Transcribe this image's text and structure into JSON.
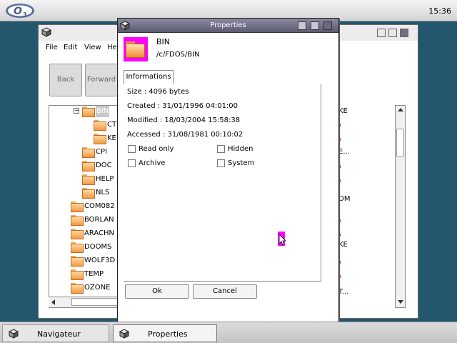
{
  "clock": "15:36",
  "navigator": {
    "menu": [
      "File",
      "Edit",
      "View",
      "He"
    ],
    "buttons": {
      "back": "Back",
      "forward": "Forward"
    },
    "tree": [
      {
        "label": "BIN",
        "indent": 2
      },
      {
        "label": "CT",
        "indent": 3
      },
      {
        "label": "KE",
        "indent": 3
      },
      {
        "label": "CPI",
        "indent": 1
      },
      {
        "label": "DOC",
        "indent": 1
      },
      {
        "label": "HELP",
        "indent": 1
      },
      {
        "label": "NLS",
        "indent": 1
      },
      {
        "label": "COM082",
        "indent": 0
      },
      {
        "label": "BORLAN",
        "indent": 0
      },
      {
        "label": "ARACHN",
        "indent": 0
      },
      {
        "label": "DOOMS",
        "indent": 0
      },
      {
        "label": "WOLF3D",
        "indent": 0
      },
      {
        "label": "TEMP",
        "indent": 0
      },
      {
        "label": "OZONE",
        "indent": 0
      }
    ],
    "right_column": [
      "KE",
      "E...",
      "OM",
      "KE",
      "T..."
    ],
    "footer": "erved."
  },
  "dialog": {
    "title": "Properties",
    "name": "BIN",
    "path": "/c/FDOS/BIN",
    "tab": "Informations",
    "size": "Size : 4096 bytes",
    "created": "Created  : 31/01/1996 04:01:00",
    "modified": "Modified : 18/03/2004 15:58:38",
    "accessed": "Accessed : 31/08/1981 00:10:02",
    "checkboxes": {
      "read_only": "Read only",
      "hidden": "Hidden",
      "archive": "Archive",
      "system": "System"
    },
    "ok": "Ok",
    "cancel": "Cancel"
  },
  "taskbar": [
    {
      "label": "Navigateur"
    },
    {
      "label": "Properties"
    }
  ]
}
